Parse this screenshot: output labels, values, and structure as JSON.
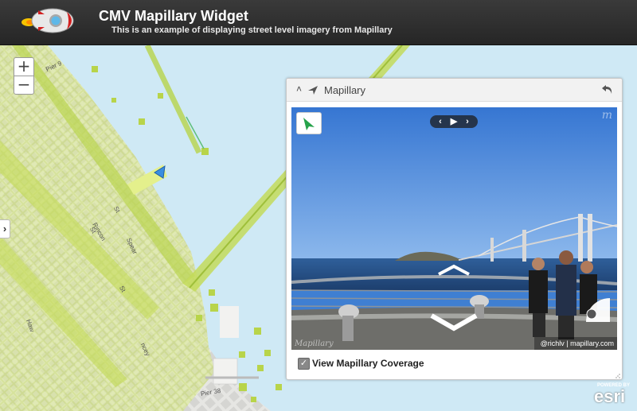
{
  "app": {
    "title": "CMV Mapillary Widget",
    "subtitle": "This is an example of displaying street level imagery from Mapillary"
  },
  "map": {
    "zoom_in_label": "+",
    "zoom_out_label": "−",
    "sidebar_toggle_label": "›",
    "labels": {
      "pier9": "Pier 9",
      "pier38": "Pier 38",
      "st_a": "St",
      "st_b": "St",
      "st_c": "St",
      "spear": "Spear",
      "hawthorne": "Haw",
      "rincon": "Rincon",
      "delancey": "ncey"
    },
    "coverage_color": "#d4e87a",
    "water_color": "#cfe9f5",
    "land_color": "#e9e9e6"
  },
  "panel": {
    "title": "Mapillary",
    "collapse_icon": "˄",
    "viewer": {
      "nav_prev": "‹",
      "nav_play": "▶",
      "nav_next": "›",
      "watermark": "m",
      "bottom_logo": "Mapillary",
      "attribution": "@richlv | mapillary.com"
    },
    "coverage_checkbox": {
      "label": "View Mapillary Coverage",
      "checked": true,
      "check_glyph": "✓"
    }
  },
  "esri": {
    "powered_by": "POWERED BY",
    "name": "esri"
  },
  "icons": {
    "logo": "rocket-logo",
    "widget": "mapillary-compass-icon",
    "undock": "undock-arrow-icon",
    "compass": "green-compass-arrow-icon"
  }
}
